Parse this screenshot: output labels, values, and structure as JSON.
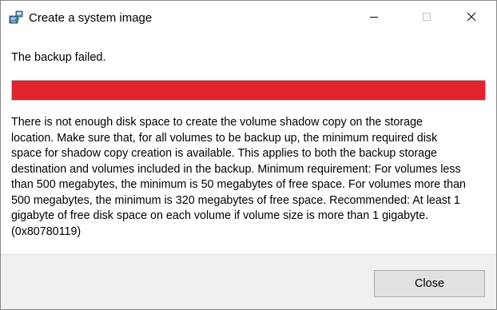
{
  "window": {
    "title": "Create a system image",
    "app_icon": "system-image-backup-icon",
    "caption_buttons": {
      "minimize_icon": "minimize-icon",
      "maximize_icon": "maximize-icon",
      "close_icon": "close-icon"
    }
  },
  "status": {
    "text": "The backup failed."
  },
  "progress": {
    "fraction": 1.0,
    "color": "#e0232d",
    "track_color": "#e6e6e6"
  },
  "message": {
    "text": "There is not enough disk space to create the volume shadow copy on the storage\nlocation. Make sure that, for all volumes to be backup up, the minimum required disk\nspace for shadow copy creation is available. This applies to both the backup storage\ndestination and volumes included in the backup. Minimum requirement: For volumes less\nthan 500 megabytes, the minimum is 50 megabytes of free space. For volumes more than\n500 megabytes, the minimum is 320 megabytes of free space.  Recommended: At least 1\ngigabyte of free disk space on each volume if volume size is more than 1 gigabyte.\n(0x80780119)"
  },
  "footer": {
    "close_label": "Close"
  }
}
